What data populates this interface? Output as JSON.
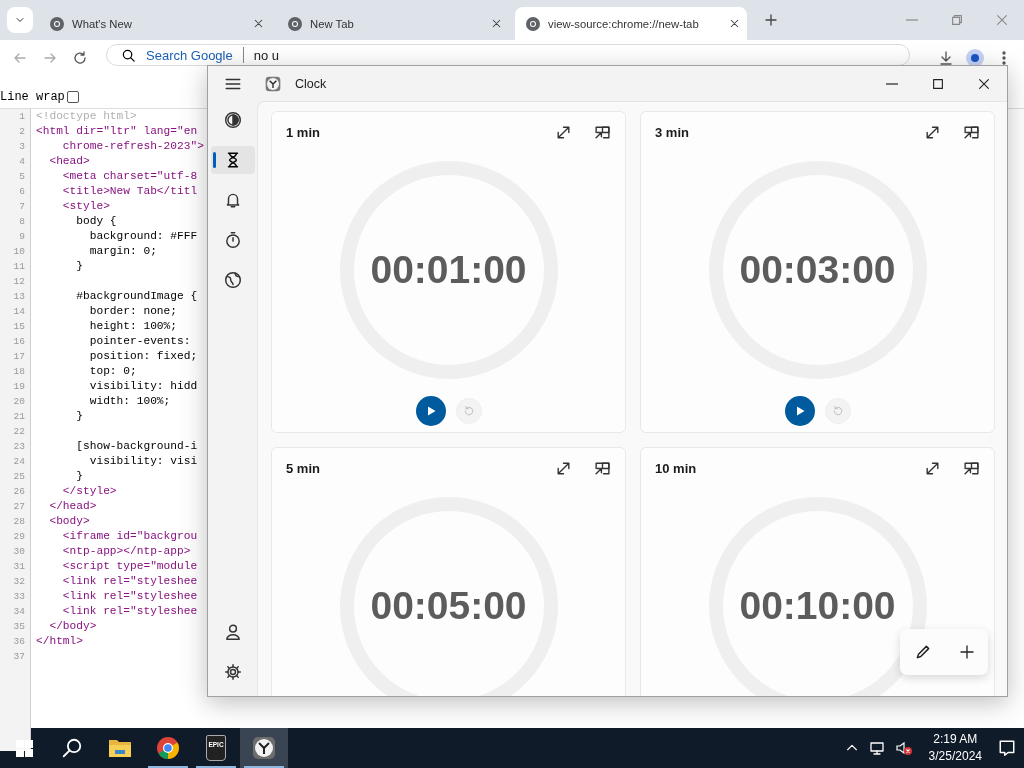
{
  "browser": {
    "tabs": [
      {
        "title": "What's New",
        "selected": false
      },
      {
        "title": "New Tab",
        "selected": false
      },
      {
        "title": "view-source:chrome://new-tab",
        "selected": true
      }
    ],
    "omnibox": {
      "placeholder": "Search Google",
      "value": "no u"
    },
    "line_wrap": {
      "label": "Line wrap",
      "checked": false
    },
    "source_lines": [
      {
        "number": "1",
        "text": "<!doctype html>",
        "kind": "doctype"
      },
      {
        "number": "2",
        "text": "<html dir=\"ltr\" lang=\"en",
        "kind": "tag"
      },
      {
        "number": "3",
        "text": "    chrome-refresh-2023\">",
        "kind": "tag"
      },
      {
        "number": "4",
        "text": "  <head>",
        "kind": "tag"
      },
      {
        "number": "5",
        "text": "    <meta charset=\"utf-8",
        "kind": "tag"
      },
      {
        "number": "6",
        "text": "    <title>New Tab</titl",
        "kind": "tag"
      },
      {
        "number": "7",
        "text": "    <style>",
        "kind": "tag"
      },
      {
        "number": "8",
        "text": "      body {",
        "kind": "text"
      },
      {
        "number": "9",
        "text": "        background: #FFF",
        "kind": "text"
      },
      {
        "number": "10",
        "text": "        margin: 0;",
        "kind": "text"
      },
      {
        "number": "11",
        "text": "      }",
        "kind": "text"
      },
      {
        "number": "12",
        "kind": "text"
      },
      {
        "number": "13",
        "text": "      #backgroundImage {",
        "kind": "text"
      },
      {
        "number": "14",
        "text": "        border: none;",
        "kind": "text"
      },
      {
        "number": "15",
        "text": "        height: 100%;",
        "kind": "text"
      },
      {
        "number": "16",
        "text": "        pointer-events:",
        "kind": "text"
      },
      {
        "number": "17",
        "text": "        position: fixed;",
        "kind": "text"
      },
      {
        "number": "18",
        "text": "        top: 0;",
        "kind": "text"
      },
      {
        "number": "19",
        "text": "        visibility: hidd",
        "kind": "text"
      },
      {
        "number": "20",
        "text": "        width: 100%;",
        "kind": "text"
      },
      {
        "number": "21",
        "text": "      }",
        "kind": "text"
      },
      {
        "number": "22",
        "kind": "text"
      },
      {
        "number": "23",
        "text": "      [show-background-i",
        "kind": "text"
      },
      {
        "number": "24",
        "text": "        visibility: visi",
        "kind": "text"
      },
      {
        "number": "25",
        "text": "      }",
        "kind": "text"
      },
      {
        "number": "26",
        "text": "    </style>",
        "kind": "tag"
      },
      {
        "number": "27",
        "text": "  </head>",
        "kind": "tag"
      },
      {
        "number": "28",
        "text": "  <body>",
        "kind": "tag"
      },
      {
        "number": "29",
        "text": "    <iframe id=\"backgrou",
        "kind": "tag"
      },
      {
        "number": "30",
        "text": "    <ntp-app></ntp-app>",
        "kind": "tag"
      },
      {
        "number": "31",
        "text": "    <script type=\"module",
        "kind": "tag"
      },
      {
        "number": "32",
        "text": "    <link rel=\"styleshee",
        "kind": "tag"
      },
      {
        "number": "33",
        "text": "    <link rel=\"styleshee",
        "kind": "tag"
      },
      {
        "number": "34",
        "text": "    <link rel=\"styleshee",
        "kind": "tag"
      },
      {
        "number": "35",
        "text": "  </body>",
        "kind": "tag"
      },
      {
        "number": "36",
        "text": "</html>",
        "kind": "tag"
      },
      {
        "number": "37",
        "kind": "text"
      }
    ]
  },
  "clock_window": {
    "title": "Clock",
    "nav": [
      {
        "kind": "focus",
        "selected": false
      },
      {
        "kind": "timer",
        "selected": true
      },
      {
        "kind": "alarm",
        "selected": false
      },
      {
        "kind": "stopwatch",
        "selected": false
      },
      {
        "kind": "world",
        "selected": false
      }
    ],
    "timers": [
      {
        "title": "1 min",
        "time": "00:01:00",
        "controls": [
          {
            "kind": "play",
            "disabled": false
          },
          {
            "kind": "reset",
            "disabled": true
          }
        ]
      },
      {
        "title": "3 min",
        "time": "00:03:00",
        "controls": [
          {
            "kind": "play",
            "disabled": false
          },
          {
            "kind": "reset",
            "disabled": true
          }
        ]
      },
      {
        "title": "5 min",
        "time": "00:05:00"
      },
      {
        "title": "10 min",
        "time": "00:10:00"
      }
    ]
  },
  "taskbar": {
    "apps": [
      {
        "kind": "folder",
        "running": false,
        "active": false
      },
      {
        "kind": "chrome",
        "running": true,
        "active": false
      },
      {
        "kind": "epic",
        "label": "EPIC",
        "running": true,
        "active": false
      },
      {
        "kind": "clock",
        "running": true,
        "active": true
      }
    ],
    "time": "2:19 AM",
    "date": "3/25/2024"
  }
}
